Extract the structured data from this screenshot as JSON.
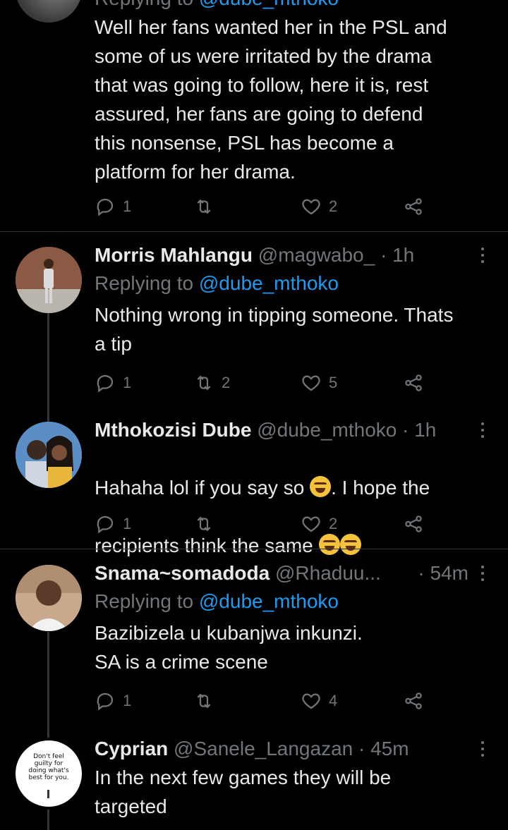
{
  "tweets": [
    {
      "replying_prefix": "Replying to",
      "replying_handle": "@dube_mthoko",
      "text": "Well her fans wanted her in the PSL and\nsome of us were irritated by the drama\nthat was going to follow, here it is, rest\nassured, her fans are going to defend\nthis nonsense, PSL has  become a\nplatform for her drama.",
      "reply_count": "1",
      "retweet_count": "",
      "like_count": "2"
    },
    {
      "name": "Morris Mahlangu",
      "handle": "@magwabo_",
      "time": "· 1h",
      "replying_prefix": "Replying to",
      "replying_handle": "@dube_mthoko",
      "text": "Nothing wrong in tipping someone. Thats\na tip",
      "reply_count": "1",
      "retweet_count": "2",
      "like_count": "5"
    },
    {
      "name": "Mthokozisi Dube",
      "handle": "@dube_mthoko",
      "time": "· 1h",
      "text_part1": "Hahaha lol if you say so ",
      "text_part2": ". I hope the",
      "text_part3": "recipients think the same ",
      "reply_count": "1",
      "retweet_count": "",
      "like_count": "2"
    },
    {
      "name": "Snama~somadoda",
      "handle": "@Rhaduu...",
      "time": "· 54m",
      "replying_prefix": "Replying to",
      "replying_handle": "@dube_mthoko",
      "text": "Bazibizela u kubanjwa inkunzi.\nSA is a crime scene",
      "reply_count": "1",
      "retweet_count": "",
      "like_count": "4"
    },
    {
      "name": "Cyprian",
      "handle": "@Sanele_Langazan",
      "time": "· 45m",
      "avatar_text": "Don't feel guilty for doing what's best for you.",
      "text": "In the next few games they will be\ntargeted"
    }
  ],
  "icons": {
    "reply": "reply-icon",
    "retweet": "retweet-icon",
    "like": "heart-icon",
    "share": "share-icon",
    "more": "more-icon",
    "emoji": "rolling-laughing-emoji"
  },
  "colors": {
    "background": "#000000",
    "text": "#e7e9ea",
    "secondary": "#71767b",
    "link": "#1d9bf0",
    "divider": "#2f3336"
  }
}
